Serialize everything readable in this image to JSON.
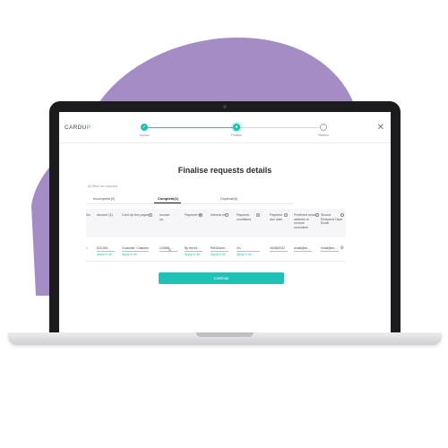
{
  "app": {
    "logo_main": "CARDU",
    "logo_accent": "P"
  },
  "stepper": {
    "steps": [
      {
        "label": "Upload"
      },
      {
        "label": "Finalise"
      },
      {
        "label": "Review"
      }
    ]
  },
  "page": {
    "title": "Finalise requests details",
    "note": "All fields are required"
  },
  "tabs": [
    {
      "label": "Incomplete(0)"
    },
    {
      "label": "Complete(1)"
    },
    {
      "label": "Duplicat(0)"
    }
  ],
  "table": {
    "headers": [
      "No.",
      "Amount (£)",
      "Card Up the payee",
      "Invoice no.",
      "Payment ref",
      "Internal ref",
      "Payment conditions",
      "Payment due date",
      "Preferred email address to receive reminders",
      "Should Recipient Have Email"
    ],
    "row": {
      "num": "1",
      "amount": "£20,000...",
      "payee": "Customer, Customer",
      "invoice": "123456...",
      "payment_ref": "By the thi...",
      "internal_ref": "Ref1Some...",
      "conditions": "On",
      "due_date": "16/08/2022",
      "email": "email@ex...",
      "recipient_email": "email@ex...",
      "apply_label": "Apply to all"
    }
  },
  "actions": {
    "continue_label": "Continue"
  },
  "colors": {
    "accent": "#1fbfb3",
    "blob": "#a48cc5",
    "laptop": "#1c1c1e"
  }
}
